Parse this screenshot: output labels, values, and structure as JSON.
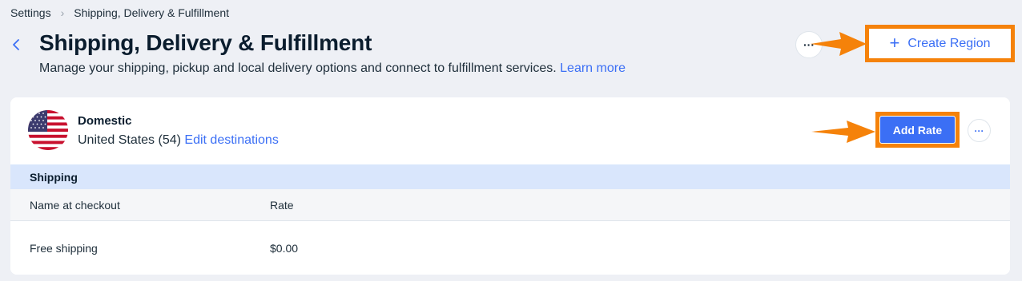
{
  "breadcrumb": {
    "root": "Settings",
    "separator": "›",
    "current": "Shipping, Delivery & Fulfillment"
  },
  "header": {
    "back_icon": "chevron-left-icon",
    "title": "Shipping, Delivery & Fulfillment",
    "subtitle": "Manage your shipping, pickup and local delivery options and connect to fulfillment services.",
    "learn_more": "Learn more",
    "more_label": "···",
    "create_region_icon": "plus-icon",
    "create_region_plus": "+",
    "create_region_label": "Create Region"
  },
  "region": {
    "flag_icon": "us-flag-icon",
    "name": "Domestic",
    "destinations": "United States (54)",
    "edit_link": "Edit destinations",
    "add_rate_label": "Add Rate",
    "more_label": "···"
  },
  "shipping": {
    "section_title": "Shipping",
    "columns": [
      "Name at checkout",
      "Rate"
    ],
    "rows": [
      {
        "name": "Free shipping",
        "rate": "$0.00"
      }
    ]
  },
  "colors": {
    "accent": "#3b6ff5",
    "highlight": "#f5820a",
    "section_bar": "#d9e6fc",
    "background": "#eef0f5"
  }
}
